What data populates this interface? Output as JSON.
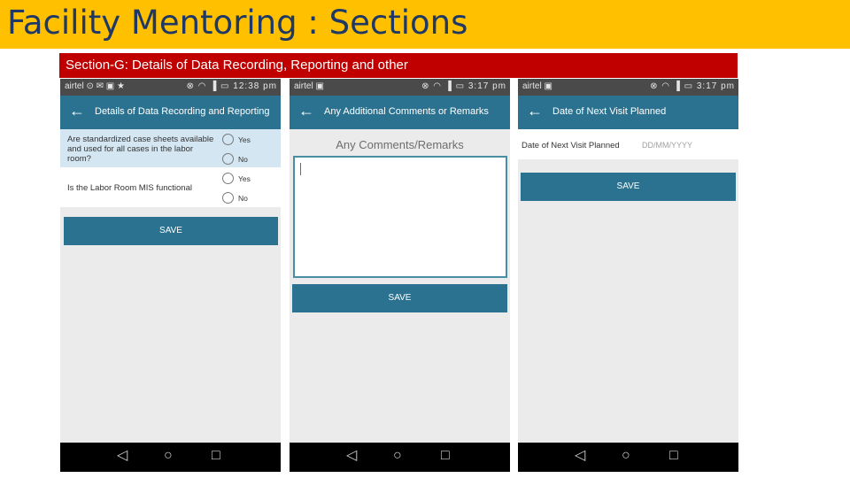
{
  "slide": {
    "title": "Facility Mentoring : Sections",
    "section_label": "Section-G: Details of Data Recording, Reporting and other",
    "colors": {
      "title_bar": "#ffc000",
      "title_text": "#1f3864",
      "section_bar": "#c00000",
      "app_bar": "#2b7290"
    }
  },
  "screens": [
    {
      "status": {
        "carrier": "airtel",
        "left_icons": "⊙ ✉ ▣ ★",
        "right_icons": "⊗ ◠ ▐ ▭",
        "time": "12:38 pm"
      },
      "app_bar": {
        "title": "Details of Data Recording and Reporting",
        "back_icon": "←"
      },
      "questions": [
        {
          "text": "Are standardized case sheets available and used for all cases in the labor room?",
          "options": [
            "Yes",
            "No"
          ]
        },
        {
          "text": "Is the Labor Room MIS  functional",
          "options": [
            "Yes",
            "No"
          ]
        }
      ],
      "save_label": "SAVE",
      "nav": {
        "back": "◁",
        "home": "○",
        "recent": "□"
      }
    },
    {
      "status": {
        "carrier": "airtel",
        "left_icons": "▣",
        "right_icons": "⊗ ◠ ▐ ▭",
        "time": "3:17 pm"
      },
      "app_bar": {
        "title": "Any Additional Comments or Remarks",
        "back_icon": "←"
      },
      "comments_label": "Any Comments/Remarks",
      "comments_value": "",
      "save_label": "SAVE",
      "nav": {
        "back": "◁",
        "home": "○",
        "recent": "□"
      }
    },
    {
      "status": {
        "carrier": "airtel",
        "left_icons": "▣",
        "right_icons": "⊗ ◠ ▐ ▭",
        "time": "3:17 pm"
      },
      "app_bar": {
        "title": "Date of Next Visit Planned",
        "back_icon": "←"
      },
      "date_label": "Date of Next Visit Planned",
      "date_placeholder": "DD/MM/YYYY",
      "save_label": "SAVE",
      "nav": {
        "back": "◁",
        "home": "○",
        "recent": "□"
      }
    }
  ]
}
